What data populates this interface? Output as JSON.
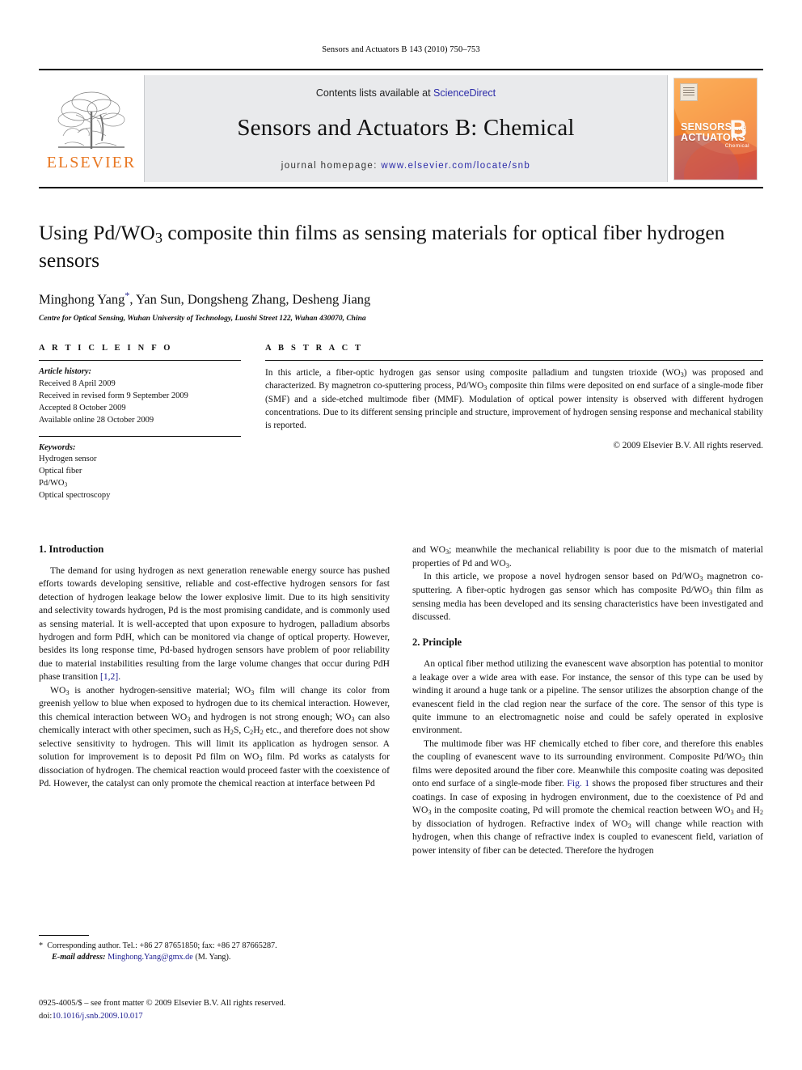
{
  "running_head": "Sensors and Actuators B 143 (2010) 750–753",
  "masthead": {
    "contents_prefix": "Contents lists available at",
    "contents_link": "ScienceDirect",
    "journal_title": "Sensors and Actuators B: Chemical",
    "homepage_prefix": "journal homepage:",
    "homepage_url": "www.elsevier.com/locate/snb",
    "publisher": "ELSEVIER",
    "cover": {
      "line1": "SENSORS",
      "line1_small": "and",
      "line2": "ACTUATORS",
      "letter": "B",
      "sub": "Chemical"
    }
  },
  "article": {
    "title": "Using Pd/WO3 composite thin films as sensing materials for optical fiber hydrogen sensors",
    "title_part1": "Using Pd/WO",
    "title_sub": "3",
    "title_part2": " composite thin films as sensing materials for optical fiber hydrogen sensors",
    "authors": "Minghong Yang*, Yan Sun, Dongsheng Zhang, Desheng Jiang",
    "authors_plain": "Minghong Yang",
    "authors_rest": ", Yan Sun, Dongsheng Zhang, Desheng Jiang",
    "affiliation": "Centre for Optical Sensing, Wuhan University of Technology, Luoshi Street 122, Wuhan 430070, China"
  },
  "info": {
    "heading": "A R T I C L E  I N F O",
    "history_label": "Article history:",
    "history": [
      "Received 8 April 2009",
      "Received in revised form 9 September 2009",
      "Accepted 8 October 2009",
      "Available online 28 October 2009"
    ],
    "keywords_label": "Keywords:",
    "keywords": [
      "Hydrogen sensor",
      "Optical fiber",
      "Pd/WO3",
      "Optical spectroscopy"
    ]
  },
  "abstract": {
    "heading": "A B S T R A C T",
    "text_p1": "In this article, a fiber-optic hydrogen gas sensor using composite palladium and tungsten trioxide (WO",
    "text_p2": ") was proposed and characterized. By magnetron co-sputtering process, Pd/WO",
    "text_p3": " composite thin films were deposited on end surface of a single-mode fiber (SMF) and a side-etched multimode fiber (MMF). Modulation of optical power intensity is observed with different hydrogen concentrations. Due to its different sensing principle and structure, improvement of hydrogen sensing response and mechanical stability is reported.",
    "copyright": "© 2009 Elsevier B.V. All rights reserved."
  },
  "sections": {
    "intro_heading": "1. Introduction",
    "principle_heading": "2. Principle"
  },
  "body": {
    "left_p1": "The demand for using hydrogen as next generation renewable energy source has pushed efforts towards developing sensitive, reliable and cost-effective hydrogen sensors for fast detection of hydrogen leakage below the lower explosive limit. Due to its high sensitivity and selectivity towards hydrogen, Pd is the most promising candidate, and is commonly used as sensing material. It is well-accepted that upon exposure to hydrogen, palladium absorbs hydrogen and form PdH, which can be monitored via change of optical property. However, besides its long response time, Pd-based hydrogen sensors have problem of poor reliability due to material instabilities resulting from the large volume changes that occur during PdH phase transition ",
    "left_p1_ref": "[1,2]",
    "left_p1_end": ".",
    "left_p2_a": "WO",
    "left_p2_b": " is another hydrogen-sensitive material; WO",
    "left_p2_c": " film will change its color from greenish yellow to blue when exposed to hydrogen due to its chemical interaction. However, this chemical interaction between WO",
    "left_p2_d": " and hydrogen is not strong enough; WO",
    "left_p2_e": " can also chemically interact with other specimen, such as H",
    "left_p2_f": "S, C",
    "left_p2_g": "H",
    "left_p2_h": " etc., and therefore does not show selective sensitivity to hydrogen. This will limit its application as hydrogen sensor. A solution for improvement is to deposit Pd film on WO",
    "left_p2_i": " film. Pd works as catalysts for dissociation of hydrogen. The chemical reaction would proceed faster with the coexistence of Pd. However, the catalyst can only promote the chemical reaction at interface between Pd",
    "right_p1_a": "and WO",
    "right_p1_b": "; meanwhile the mechanical reliability is poor due to the mismatch of material properties of Pd and WO",
    "right_p1_c": ".",
    "right_p2_a": "In this article, we propose a novel hydrogen sensor based on Pd/WO",
    "right_p2_b": " magnetron co-sputtering. A fiber-optic hydrogen gas sensor which has composite Pd/WO",
    "right_p2_c": " thin film as sensing media has been developed and its sensing characteristics have been investigated and discussed.",
    "right_p3": "An optical fiber method utilizing the evanescent wave absorption has potential to monitor a leakage over a wide area with ease. For instance, the sensor of this type can be used by winding it around a huge tank or a pipeline. The sensor utilizes the absorption change of the evanescent field in the clad region near the surface of the core. The sensor of this type is quite immune to an electromagnetic noise and could be safely operated in explosive environment.",
    "right_p4_a": "The multimode fiber was HF chemically etched to fiber core, and therefore this enables the coupling of evanescent wave to its surrounding environment. Composite Pd/WO",
    "right_p4_b": " thin films were deposited around the fiber core. Meanwhile this composite coating was deposited onto end surface of a single-mode fiber. ",
    "right_p4_fig": "Fig. 1",
    "right_p4_c": " shows the proposed fiber structures and their coatings. In case of exposing in hydrogen environment, due to the coexistence of Pd and WO",
    "right_p4_d": " in the composite coating, Pd will promote the chemical reaction between WO",
    "right_p4_e": " and H",
    "right_p4_f": " by dissociation of hydrogen. Refractive index of WO",
    "right_p4_g": " will change while reaction with hydrogen, when this change of refractive index is coupled to evanescent field, variation of power intensity of fiber can be detected. Therefore the hydrogen"
  },
  "footnote": {
    "star": "*",
    "corresponding": "Corresponding author. Tel.: +86 27 87651850; fax: +86 27 87665287.",
    "email_label": "E-mail address:",
    "email": "Minghong.Yang@gmx.de",
    "email_suffix": "(M. Yang)."
  },
  "imprint": {
    "line1": "0925-4005/$ – see front matter © 2009 Elsevier B.V. All rights reserved.",
    "doi_label": "doi:",
    "doi": "10.1016/j.snb.2009.10.017"
  },
  "colors": {
    "link": "#1b1b8f",
    "elsevier_orange": "#E87722",
    "band_bg": "#e9eaec"
  }
}
